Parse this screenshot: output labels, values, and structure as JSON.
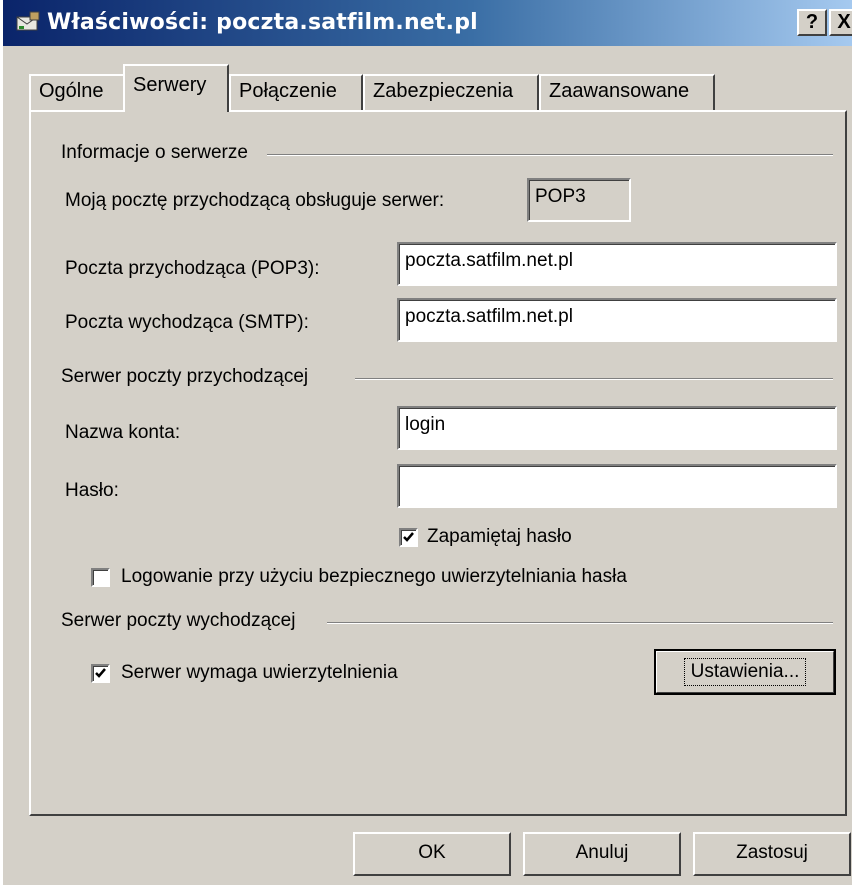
{
  "window": {
    "title": "Właściwości: poczta.satfilm.net.pl",
    "help_label": "?",
    "close_label": "X",
    "title_icon": "mail-server-icon"
  },
  "tabs": [
    {
      "label": "Ogólne",
      "active": false
    },
    {
      "label": "Serwery",
      "active": true
    },
    {
      "label": "Połączenie",
      "active": false
    },
    {
      "label": "Zabezpieczenia",
      "active": false
    },
    {
      "label": "Zaawansowane",
      "active": false
    }
  ],
  "server_info": {
    "group_label": "Informacje o serwerze",
    "incoming_type_label": "Moją pocztę przychodzącą obsługuje serwer:",
    "incoming_type_value": "POP3",
    "pop3_label": "Poczta przychodząca (POP3):",
    "pop3_value": "poczta.satfilm.net.pl",
    "smtp_label": "Poczta wychodząca (SMTP):",
    "smtp_value": "poczta.satfilm.net.pl"
  },
  "incoming_server": {
    "group_label": "Serwer poczty przychodzącej",
    "account_label": "Nazwa konta:",
    "account_value": "login",
    "password_label": "Hasło:",
    "password_value": "",
    "remember_label": "Zapamiętaj hasło",
    "remember_checked": true,
    "spa_label": "Logowanie przy użyciu bezpiecznego uwierzytelniania hasła",
    "spa_checked": false
  },
  "outgoing_server": {
    "group_label": "Serwer poczty wychodzącej",
    "auth_label": "Serwer wymaga uwierzytelnienia",
    "auth_checked": true,
    "settings_label": "Ustawienia..."
  },
  "buttons": {
    "ok": "OK",
    "cancel": "Anuluj",
    "apply": "Zastosuj"
  }
}
